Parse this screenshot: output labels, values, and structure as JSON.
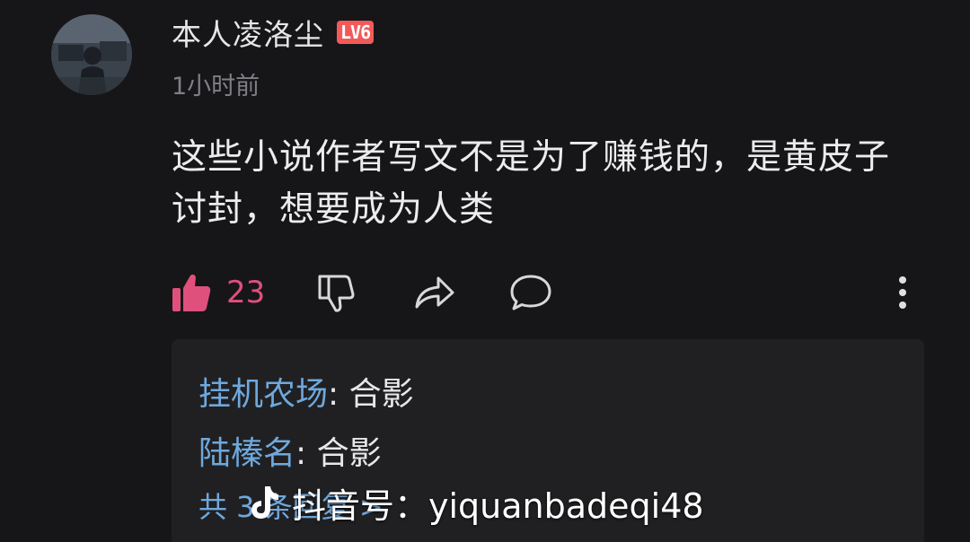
{
  "comment": {
    "username": "本人凌洛尘",
    "level_badge": "LV6",
    "timestamp": "1小时前",
    "text": "这些小说作者写文不是为了赚钱的，是黄皮子讨封，想要成为人类",
    "like_count": "23"
  },
  "replies": [
    {
      "author": "挂机农场",
      "separator": ": ",
      "text": "合影"
    },
    {
      "author": "陆榛名",
      "separator": ": ",
      "text": "合影"
    }
  ],
  "view_all_replies": "共 3 条回复 >",
  "watermark": {
    "text": "抖音号：yiquanbadeqi48",
    "icon": "douyin-logo-icon"
  },
  "colors": {
    "background": "#161618",
    "like_accent": "#e0507d",
    "level_badge": "#f25a5a",
    "link_blue": "#6fa8dc",
    "reply_box": "#202022"
  }
}
